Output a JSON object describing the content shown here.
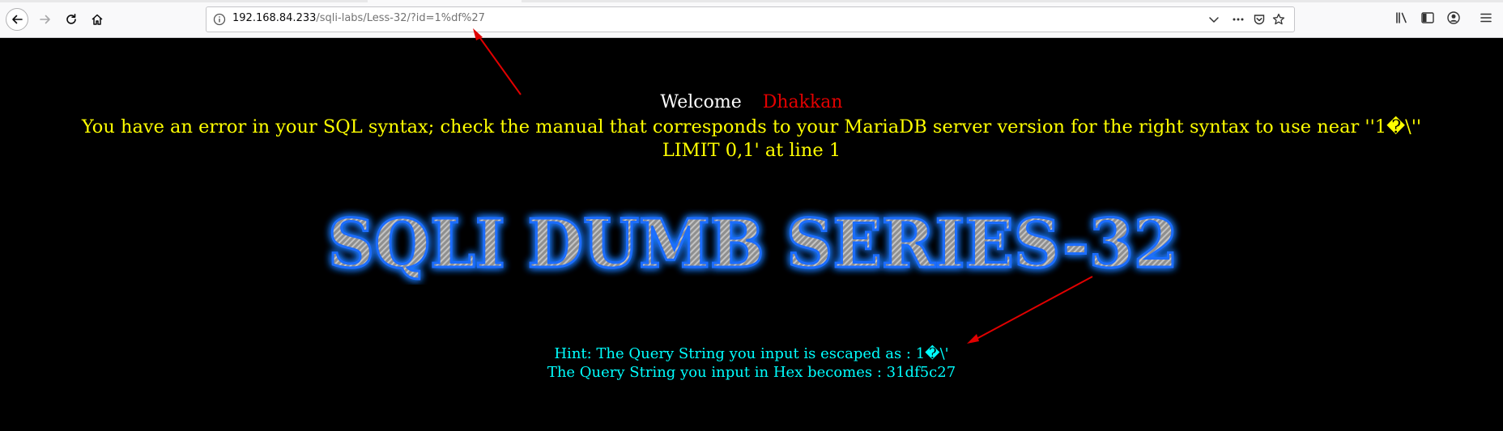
{
  "browser": {
    "url_host": "192.168.84.233",
    "url_path": "/sqli-labs/Less-32/?id=1%df%27"
  },
  "page": {
    "welcome_label": "Welcome",
    "welcome_name": "Dhakkan",
    "error_line1": "You have an error in your SQL syntax; check the manual that corresponds to your MariaDB server version for the right syntax to use near ''1�\\''",
    "error_line2": "LIMIT 0,1' at line 1",
    "banner_text": "SQLI DUMB SERIES-32",
    "hint_line1": "Hint: The Query String you input is escaped as : 1�\\'",
    "hint_line2": "The Query String you input in Hex becomes : 31df5c27"
  },
  "colors": {
    "welcome": "#ffffff",
    "name": "#e30000",
    "error": "#ffff00",
    "hint": "#00ffff",
    "annotation_arrow": "#e00000"
  },
  "icons": {
    "back": "arrow-left-icon",
    "forward": "arrow-right-icon",
    "reload": "reload-icon",
    "home": "home-icon",
    "site_info": "info-icon",
    "dropdown": "chevron-down-icon",
    "page_actions": "ellipsis-icon",
    "pocket": "pocket-icon",
    "bookmark": "star-icon",
    "library": "library-icon",
    "sidebar": "sidebar-icon",
    "account": "account-icon",
    "menu": "hamburger-menu-icon"
  }
}
